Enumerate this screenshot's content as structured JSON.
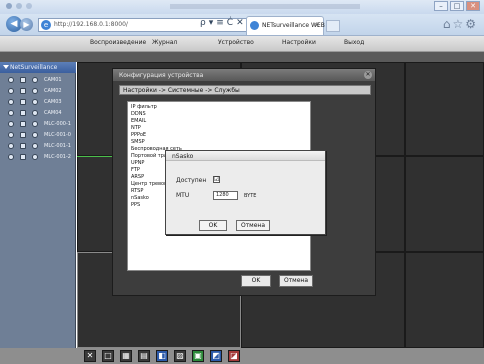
{
  "browser": {
    "url": "http://192.168.0.1:8000/",
    "tab_label": "NETsurveillance WEB",
    "tab_close": "×",
    "toolbar_glyphs": [
      "ρ",
      "▾",
      "≡",
      "Ċ",
      "✕"
    ]
  },
  "app_menu": {
    "items": [
      "Воспроизведение",
      "Журнал",
      "Устройство",
      "Настройки",
      "Выход"
    ]
  },
  "sidebar": {
    "header": "NetSurveillance",
    "cameras": [
      "CAM01",
      "CAM02",
      "CAM03",
      "CAM04",
      "MLC-000-1",
      "MLC-001-0",
      "MLC-001-1",
      "MLC-001-2"
    ]
  },
  "config_dialog": {
    "title": "Конфигурация устройства",
    "breadcrumb": "Настройки -> Системные -> Службы",
    "services": [
      "IP фильтр",
      "DDNS",
      "EMAIL",
      "NTP",
      "PPPoE",
      "SMSP",
      "Беспроводная сеть",
      "Портовой трансфер",
      "UPNP",
      "FTP",
      "ARSP",
      "Центр тревоги",
      "RTSP",
      "nSasko",
      "PPS"
    ],
    "ok_label": "OK",
    "cancel_label": "Отмена"
  },
  "sub_dialog": {
    "title": "nSasko",
    "enabled_label": "Доступен",
    "enabled_mark": "☑",
    "mtu_label": "MTU",
    "mtu_value": "1280",
    "mtu_unit": "BYTE",
    "ok_label": "OK",
    "cancel_label": "Отмена"
  },
  "bottom_icons": [
    "✕",
    "□",
    "▦",
    "▤",
    "◧",
    "▨",
    "▣",
    "◩",
    "◪"
  ]
}
